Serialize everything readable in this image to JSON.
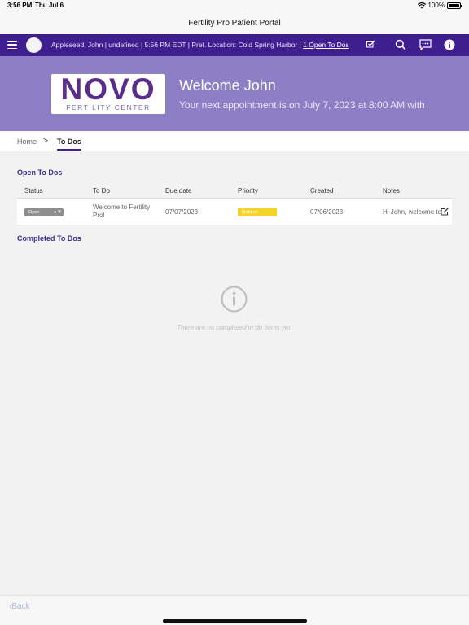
{
  "statusbar": {
    "time": "3:56 PM",
    "date": "Thu Jul 6",
    "battery": "100%"
  },
  "window": {
    "title": "Fertility Pro Patient Portal"
  },
  "navbar": {
    "info": "Appleseed, John | undefined | 5:56 PM EDT | Pref. Location: Cold Spring Harbor | ",
    "todo_link": "1 Open To Dos",
    "icons": [
      "search-icon",
      "chat-icon",
      "info-icon"
    ]
  },
  "banner": {
    "logo_main": "NOVO",
    "logo_sub": "FERTILITY CENTER",
    "welcome": "Welcome John",
    "appointment": "Your next appointment is on July 7, 2023 at 8:00 AM with"
  },
  "breadcrumb": {
    "home": "Home",
    "separator": ">",
    "current": "To Dos"
  },
  "open_todos": {
    "title": "Open To Dos",
    "columns": [
      "Status",
      "To Do",
      "Due date",
      "Priority",
      "Created",
      "Notes"
    ],
    "rows": [
      {
        "status": "Open",
        "clear": "x",
        "arrow": "▼",
        "todo": "Welcome to Fertility Pro!",
        "due": "07/07/2023",
        "priority": "Medium",
        "created": "07/06/2023",
        "notes": "Hi John, welcome to"
      }
    ]
  },
  "completed_todos": {
    "title": "Completed To Dos",
    "empty_message": "There are no completed to do items yet."
  },
  "footer": {
    "back": "Back"
  },
  "colors": {
    "nav": "#3f1f8f",
    "banner": "#8c7fc6",
    "priority_medium": "#f3d328",
    "section_title": "#3f2e8c"
  }
}
